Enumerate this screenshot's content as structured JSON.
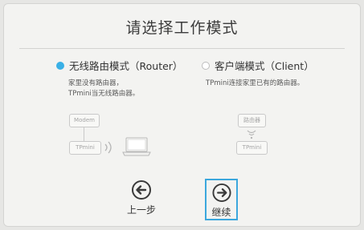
{
  "title": "请选择工作模式",
  "options": [
    {
      "label": "无线路由模式（Router）",
      "selected": true,
      "description": [
        "家里没有路由器，",
        "TPmini当无线路由器。"
      ]
    },
    {
      "label": "客户端模式（Client）",
      "selected": false,
      "description": [
        "TPmini连接家里已有的路由器。"
      ]
    }
  ],
  "diagram_left": {
    "modem": "Modem",
    "device": "TPmini"
  },
  "diagram_right": {
    "router": "路由器",
    "device": "TPmini"
  },
  "nav": {
    "back_label": "上一步",
    "next_label": "继续"
  },
  "colors": {
    "accent": "#3ab0e6",
    "highlight_border": "#3ba7dd"
  },
  "icons": {
    "back": "arrow-left-circle-icon",
    "next": "arrow-right-circle-icon",
    "wifi": "wifi-waves-icon",
    "laptop": "laptop-icon"
  }
}
